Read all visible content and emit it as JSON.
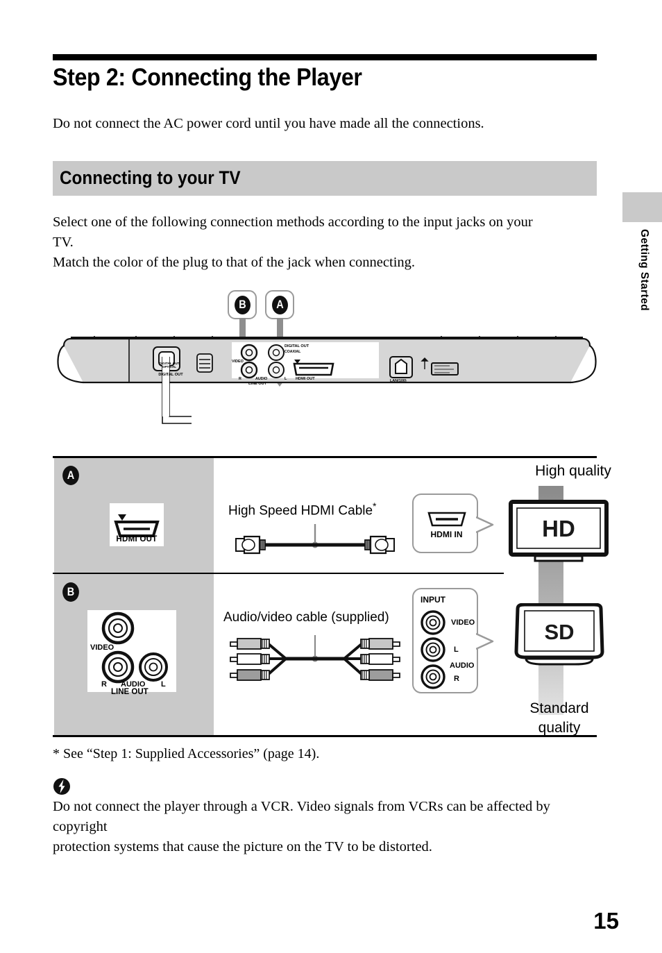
{
  "header": {
    "title": "Step 2: Connecting the Player",
    "intro": "Do not connect the AC power cord until you have made all the connections."
  },
  "section": {
    "bar_title": "Connecting to your TV",
    "lead_line1": "Select one of the following connection methods according to the input jacks on your",
    "lead_line2": "TV.",
    "lead_line3": "Match the color of the plug to that of the jack when connecting."
  },
  "side_tab": {
    "label": "Getting Started"
  },
  "diagram": {
    "callout_b": "B",
    "callout_a": "A",
    "panel_labels": {
      "digital_out": "DIGITAL  OUT",
      "optical": "OPTICAL",
      "digital_out_top": "DIGITAL OUT",
      "coaxial": "COAXIAL",
      "video": "VIDEO",
      "audio": "AUDIO",
      "line_out": "LINE OUT",
      "left": "L",
      "right": "R",
      "hdmi_out": "HDMI OUT",
      "lan": "LAN(100)"
    }
  },
  "table": {
    "rows": [
      {
        "badge": "A",
        "jack_label": "HDMI  OUT",
        "cable_label": "High Speed HDMI Cable",
        "cable_label_mark": "*",
        "input_label": "HDMI IN",
        "tv_label": "HD",
        "quality": "High quality"
      },
      {
        "badge": "B",
        "jack_video": "VIDEO",
        "jack_r": "R",
        "jack_audio": "AUDIO",
        "jack_l": "L",
        "jack_line_out": "LINE OUT",
        "cable_label": "Audio/video cable (supplied)",
        "input_title": "INPUT",
        "input_video": "VIDEO",
        "input_l": "L",
        "input_audio": "AUDIO",
        "input_r": "R",
        "tv_label": "SD",
        "quality_line1": "Standard",
        "quality_line2": "quality"
      }
    ]
  },
  "footer": {
    "footnote": "* See “Step 1: Supplied Accessories” (page 14).",
    "caution_line1": "Do not connect the player through a VCR. Video signals from VCRs can be affected by copyright",
    "caution_line2": "protection systems that cause the picture on the TV to be distorted.",
    "page_number": "15"
  },
  "colors": {
    "gray_bar": "#c9c9c9",
    "ink": "#000000",
    "outline_gray": "#9a9a9a"
  }
}
